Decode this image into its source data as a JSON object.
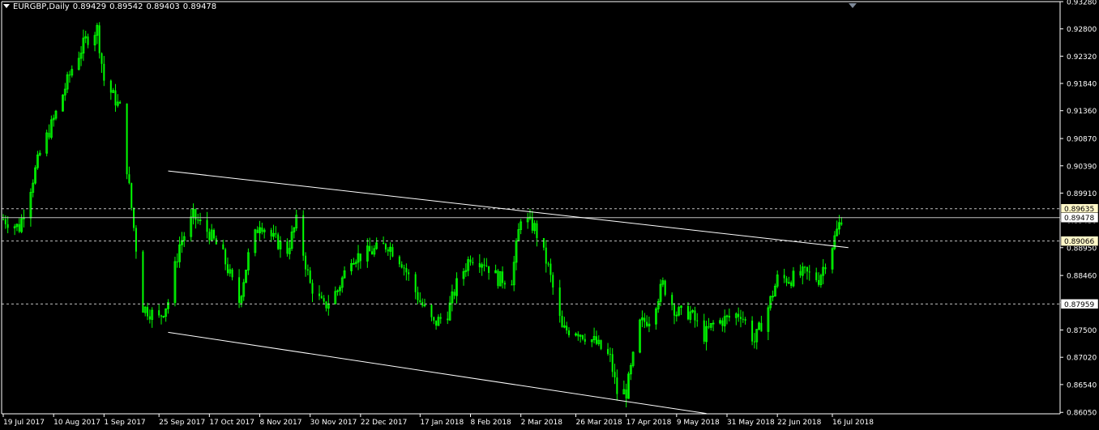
{
  "header": {
    "symbol": "EURGBP,Daily",
    "open": "0.89429",
    "high": "0.89542",
    "low": "0.89403",
    "close": "0.89478"
  },
  "chart_data": {
    "type": "candlestick",
    "symbol": "EURGBP",
    "timeframe": "Daily",
    "ylim": [
      0.86025,
      0.9328
    ],
    "y_ticks": [
      "0.93280",
      "0.92800",
      "0.92320",
      "0.91840",
      "0.91360",
      "0.90870",
      "0.90390",
      "0.89910",
      "0.89430",
      "0.88950",
      "0.88460",
      "0.87980",
      "0.87500",
      "0.87020",
      "0.86540",
      "0.86050"
    ],
    "x_ticks": [
      "19 Jul 2017",
      "10 Aug 2017",
      "1 Sep 2017",
      "25 Sep 2017",
      "17 Oct 2017",
      "8 Nov 2017",
      "30 Nov 2017",
      "22 Dec 2017",
      "17 Jan 2018",
      "8 Feb 2018",
      "2 Mar 2018",
      "26 Mar 2018",
      "17 Apr 2018",
      "9 May 2018",
      "31 May 2018",
      "22 Jun 2018",
      "16 Jul 2018"
    ],
    "price_anchors": [
      {
        "date": "19 Jul 2017",
        "close": 0.8945
      },
      {
        "date": "26 Jul 2017",
        "close": 0.893
      },
      {
        "date": "4 Aug 2017",
        "close": 0.906
      },
      {
        "date": "10 Aug 2017",
        "close": 0.912
      },
      {
        "date": "18 Aug 2017",
        "close": 0.921
      },
      {
        "date": "24 Aug 2017",
        "close": 0.926
      },
      {
        "date": "29 Aug 2017",
        "close": 0.928
      },
      {
        "date": "1 Sep 2017",
        "close": 0.919
      },
      {
        "date": "8 Sep 2017",
        "close": 0.914
      },
      {
        "date": "14 Sep 2017",
        "close": 0.893
      },
      {
        "date": "18 Sep 2017",
        "close": 0.879
      },
      {
        "date": "25 Sep 2017",
        "close": 0.877
      },
      {
        "date": "29 Sep 2017",
        "close": 0.88
      },
      {
        "date": "4 Oct 2017",
        "close": 0.89
      },
      {
        "date": "10 Oct 2017",
        "close": 0.895
      },
      {
        "date": "17 Oct 2017",
        "close": 0.892
      },
      {
        "date": "23 Oct 2017",
        "close": 0.888
      },
      {
        "date": "30 Oct 2017",
        "close": 0.88
      },
      {
        "date": "3 Nov 2017",
        "close": 0.888
      },
      {
        "date": "8 Nov 2017",
        "close": 0.894
      },
      {
        "date": "14 Nov 2017",
        "close": 0.891
      },
      {
        "date": "20 Nov 2017",
        "close": 0.889
      },
      {
        "date": "24 Nov 2017",
        "close": 0.894
      },
      {
        "date": "30 Nov 2017",
        "close": 0.883
      },
      {
        "date": "6 Dec 2017",
        "close": 0.879
      },
      {
        "date": "12 Dec 2017",
        "close": 0.882
      },
      {
        "date": "18 Dec 2017",
        "close": 0.888
      },
      {
        "date": "22 Dec 2017",
        "close": 0.888
      },
      {
        "date": "3 Jan 2018",
        "close": 0.89
      },
      {
        "date": "9 Jan 2018",
        "close": 0.887
      },
      {
        "date": "17 Jan 2018",
        "close": 0.88
      },
      {
        "date": "23 Jan 2018",
        "close": 0.876
      },
      {
        "date": "29 Jan 2018",
        "close": 0.878
      },
      {
        "date": "2 Feb 2018",
        "close": 0.883
      },
      {
        "date": "8 Feb 2018",
        "close": 0.888
      },
      {
        "date": "14 Feb 2018",
        "close": 0.887
      },
      {
        "date": "20 Feb 2018",
        "close": 0.884
      },
      {
        "date": "26 Feb 2018",
        "close": 0.884
      },
      {
        "date": "2 Mar 2018",
        "close": 0.895
      },
      {
        "date": "8 Mar 2018",
        "close": 0.893
      },
      {
        "date": "14 Mar 2018",
        "close": 0.886
      },
      {
        "date": "20 Mar 2018",
        "close": 0.875
      },
      {
        "date": "26 Mar 2018",
        "close": 0.875
      },
      {
        "date": "3 Apr 2018",
        "close": 0.873
      },
      {
        "date": "10 Apr 2018",
        "close": 0.87
      },
      {
        "date": "13 Apr 2018",
        "close": 0.864
      },
      {
        "date": "17 Apr 2018",
        "close": 0.864
      },
      {
        "date": "23 Apr 2018",
        "close": 0.876
      },
      {
        "date": "27 Apr 2018",
        "close": 0.877
      },
      {
        "date": "3 May 2018",
        "close": 0.883
      },
      {
        "date": "9 May 2018",
        "close": 0.878
      },
      {
        "date": "15 May 2018",
        "close": 0.878
      },
      {
        "date": "21 May 2018",
        "close": 0.874
      },
      {
        "date": "25 May 2018",
        "close": 0.876
      },
      {
        "date": "31 May 2018",
        "close": 0.877
      },
      {
        "date": "6 Jun 2018",
        "close": 0.878
      },
      {
        "date": "12 Jun 2018",
        "close": 0.873
      },
      {
        "date": "18 Jun 2018",
        "close": 0.879
      },
      {
        "date": "22 Jun 2018",
        "close": 0.884
      },
      {
        "date": "28 Jun 2018",
        "close": 0.884
      },
      {
        "date": "4 Jul 2018",
        "close": 0.885
      },
      {
        "date": "10 Jul 2018",
        "close": 0.884
      },
      {
        "date": "16 Jul 2018",
        "close": 0.89
      },
      {
        "date": "20 Jul 2018",
        "close": 0.89478
      }
    ],
    "horizontal_levels": [
      {
        "label": "0.89635",
        "value": 0.89635,
        "style": "dashed",
        "highlighted": true
      },
      {
        "label": "0.89478",
        "value": 0.89478,
        "style": "solid",
        "highlighted": false
      },
      {
        "label": "0.89066",
        "value": 0.89066,
        "style": "dashed",
        "highlighted": true
      },
      {
        "label": "0.87959",
        "value": 0.87959,
        "style": "dashed",
        "highlighted": false
      }
    ],
    "trendlines": [
      {
        "from": {
          "date": "29 Sep 2017",
          "price": 0.903
        },
        "to": {
          "date": "23 Jul 2018",
          "price": 0.8895
        }
      },
      {
        "from": {
          "date": "29 Sep 2017",
          "price": 0.8746
        },
        "to": {
          "date": "22 May 2018",
          "price": 0.8603
        }
      }
    ],
    "grid": false
  },
  "colors": {
    "background": "#000000",
    "candle": "#00ff00",
    "axis": "#ffffff",
    "level_highlight": "#fff7c8"
  }
}
